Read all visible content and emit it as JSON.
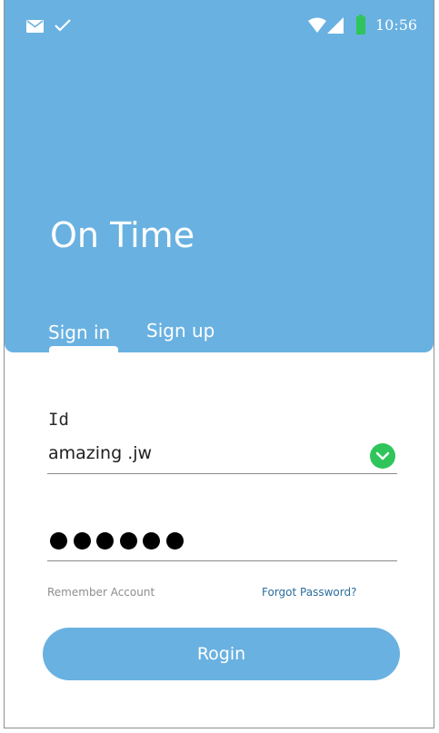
{
  "status_bar": {
    "time": "10:56",
    "icons": [
      "mail-icon",
      "check-icon",
      "wifi-icon",
      "signal-icon",
      "battery-icon"
    ]
  },
  "app": {
    "title": "On Time"
  },
  "tabs": {
    "items": [
      {
        "label": "Sign in",
        "selected": true
      },
      {
        "label": "Sign up",
        "selected": false
      }
    ]
  },
  "form": {
    "id_label": "Id",
    "id_value": "amazing .jw",
    "id_valid": true,
    "password_length": 6,
    "remember_label": "Remember Account",
    "forgot_label": "Forgot Password?",
    "submit_label": "Rogin"
  },
  "colors": {
    "primary": "#69b1e1",
    "valid": "#2fc55b",
    "link": "#2c6e9e",
    "battery": "#2fc55b"
  }
}
